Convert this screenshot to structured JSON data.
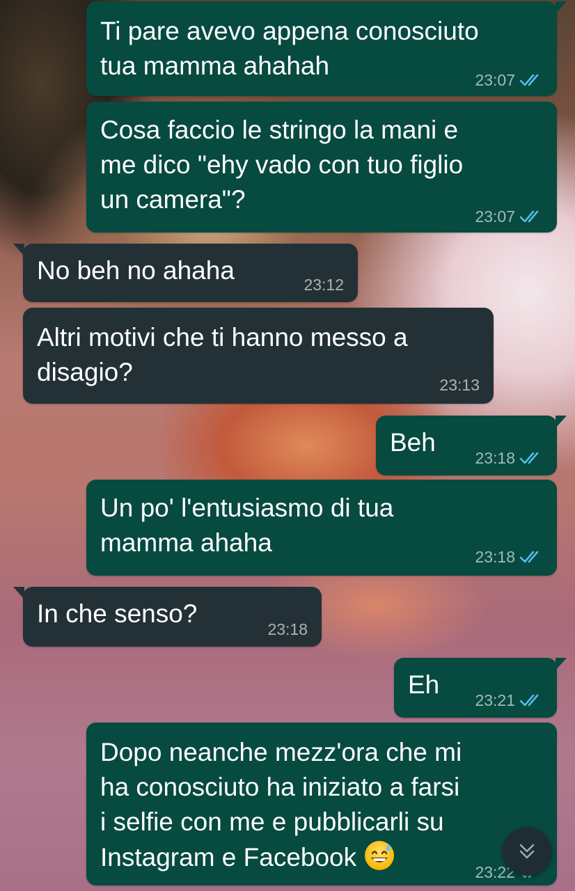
{
  "chat": {
    "messages": [
      {
        "direction": "outgoing",
        "text_lines": [
          "Ti pare avevo appena conosciuto",
          "tua mamma ahahah"
        ],
        "time": "23:07",
        "status": "read"
      },
      {
        "direction": "outgoing",
        "text_lines": [
          "Cosa faccio le stringo la mani e",
          "me dico \"ehy vado con tuo figlio",
          "un camera\"?"
        ],
        "time": "23:07",
        "status": "read"
      },
      {
        "direction": "incoming",
        "text_lines": [
          "No beh no ahaha"
        ],
        "time": "23:12"
      },
      {
        "direction": "incoming",
        "text_lines": [
          "Altri motivi che ti hanno messo a",
          "disagio?"
        ],
        "time": "23:13"
      },
      {
        "direction": "outgoing",
        "text_lines": [
          "Beh"
        ],
        "time": "23:18",
        "status": "read"
      },
      {
        "direction": "outgoing",
        "text_lines": [
          "Un po' l'entusiasmo di tua",
          "mamma ahaha"
        ],
        "time": "23:18",
        "status": "read"
      },
      {
        "direction": "incoming",
        "text_lines": [
          "In che senso?"
        ],
        "time": "23:18"
      },
      {
        "direction": "outgoing",
        "text_lines": [
          "Eh"
        ],
        "time": "23:21",
        "status": "read"
      },
      {
        "direction": "outgoing",
        "text_lines": [
          "Dopo neanche mezz'ora che mi",
          "ha conosciuto ha iniziato a farsi",
          "i selfie con me e pubblicarli su",
          "Instagram e Facebook"
        ],
        "emoji": "grinning-face-with-sweat",
        "time": "23:22",
        "status": "read"
      }
    ]
  },
  "icons": {
    "read_receipt": "double-check-icon",
    "scroll_down": "chevron-down-icon"
  },
  "colors": {
    "outgoing_bubble": "#074a40",
    "incoming_bubble": "#233137",
    "read_tick": "#53bdeb",
    "message_text": "#ffffff",
    "timestamp": "#a8b2b0"
  }
}
